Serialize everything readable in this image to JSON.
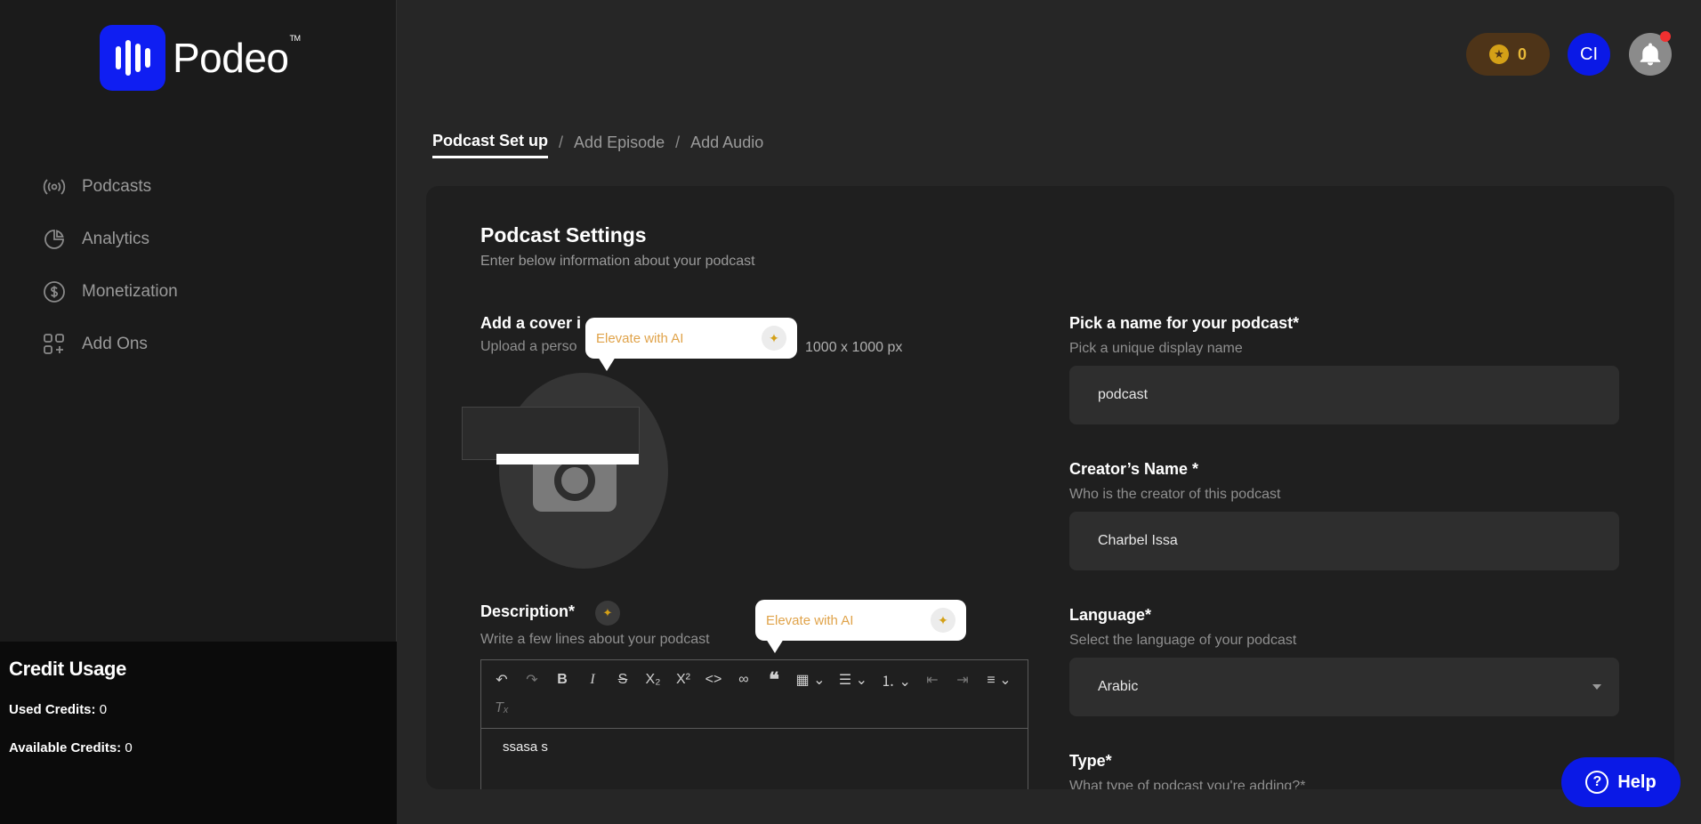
{
  "app": {
    "brand": "Podeo",
    "brand_tm": "TM"
  },
  "sidebar": {
    "items": [
      {
        "label": "Podcasts",
        "icon": "broadcast-icon"
      },
      {
        "label": "Analytics",
        "icon": "pie-chart-icon"
      },
      {
        "label": "Monetization",
        "icon": "dollar-icon"
      },
      {
        "label": "Add Ons",
        "icon": "add-ons-icon"
      }
    ],
    "credit": {
      "title": "Credit Usage",
      "used_label": "Used Credits:",
      "used_value": "0",
      "available_label": "Available Credits:",
      "available_value": "0"
    }
  },
  "header": {
    "coins": "0",
    "avatar_initials": "CI"
  },
  "breadcrumb": {
    "active": "Podcast Set up",
    "items": [
      "Add Episode",
      "Add Audio"
    ],
    "separator": "/"
  },
  "settings": {
    "title": "Podcast Settings",
    "subtitle": "Enter below information about your podcast",
    "cover": {
      "label": "Add a cover i",
      "hint": "Upload a perso",
      "size_hint": "1000 x 1000 px"
    },
    "ai_tip_1": "Elevate with AI",
    "ai_tip_2": "Elevate with AI",
    "description": {
      "label": "Description*",
      "hint": "Write a few lines about your podcast",
      "content": "ssasa s"
    },
    "name": {
      "label": "Pick a name for your podcast*",
      "hint": "Pick a unique display name",
      "value": "podcast"
    },
    "creator": {
      "label": "Creator’s Name *",
      "hint": "Who is the creator of this podcast",
      "value": "Charbel Issa"
    },
    "language": {
      "label": "Language*",
      "hint": "Select the language of your podcast",
      "value": "Arabic"
    },
    "type": {
      "label": "Type*",
      "hint": "What type of podcast you're adding?*"
    }
  },
  "help": {
    "label": "Help"
  },
  "colors": {
    "accent": "#0a19e6",
    "coin": "#e7b838",
    "ai_text": "#e0a34a"
  }
}
